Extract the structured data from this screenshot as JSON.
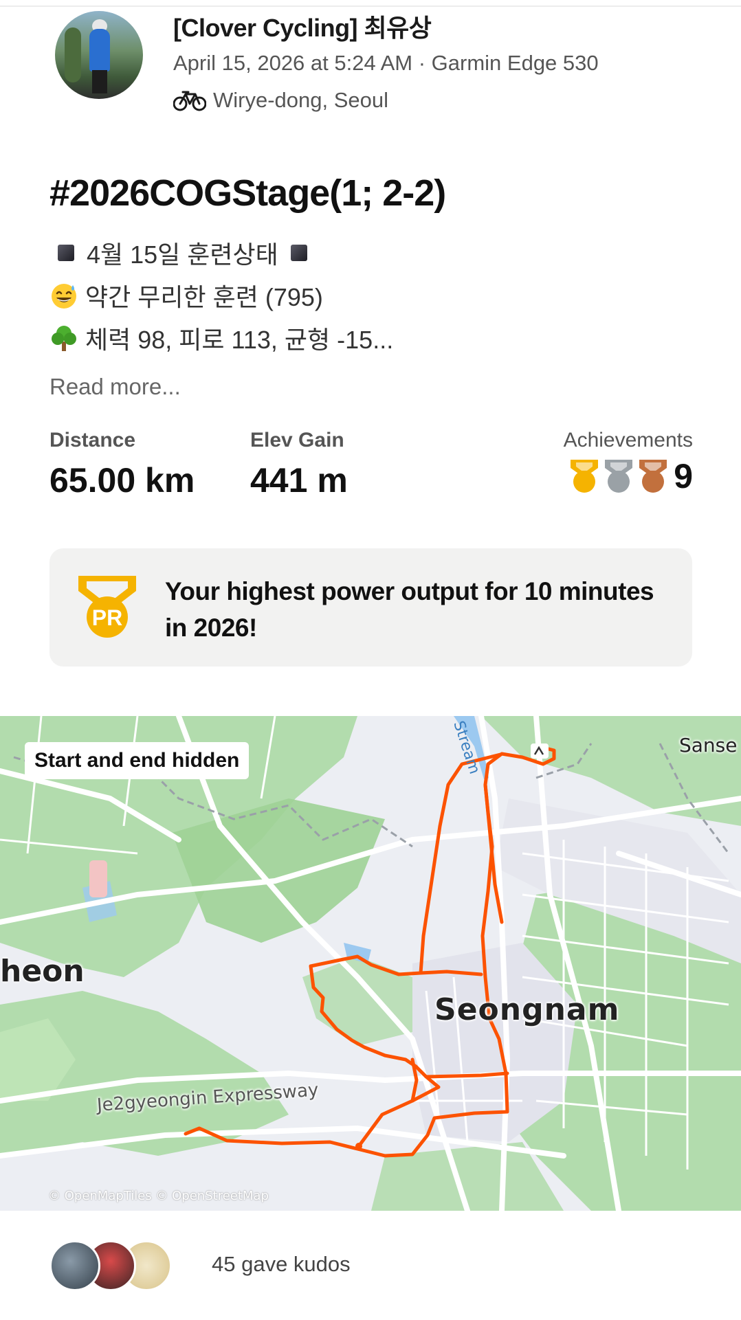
{
  "activity": {
    "athlete_name": "[Clover Cycling] 최유상",
    "meta": "April 15, 2026 at 5:24 AM · Garmin Edge 530",
    "location": "Wirye-dong, Seoul",
    "title": "#2026COGStage(1; 2-2)",
    "description_lines": [
      "4월 15일 훈련상태",
      "약간 무리한 훈련 (795)",
      "체력 98, 피로 113, 균형 -15..."
    ],
    "read_more": "Read more...",
    "icons": [
      "bike-icon",
      "black-square-icon",
      "sweat-smile-emoji",
      "tree-emoji"
    ]
  },
  "stats": {
    "distance_label": "Distance",
    "distance_value": "65.00 km",
    "elev_label": "Elev Gain",
    "elev_value": "441 m",
    "achievements_label": "Achievements",
    "achievements_count": "9",
    "medal_icons": [
      "gold-medal-icon",
      "silver-medal-icon",
      "bronze-medal-icon"
    ]
  },
  "pr_card": {
    "badge": "PR",
    "text": "Your highest power output for 10 minutes in 2026!"
  },
  "map": {
    "privacy_label": "Start and end hidden",
    "city_label": "Seongnam",
    "west_label": "heon",
    "east_label": "Sanse",
    "road_label": "Je2gyeongin Expressway",
    "stream_label": "Stream",
    "credit": "© OpenMapTiles © OpenStreetMap",
    "route_color": "#fc5200"
  },
  "kudos": {
    "text": "45 gave kudos"
  },
  "colors": {
    "accent": "#fc5200",
    "gold": "#f5b301",
    "silver": "#9aa1a6",
    "bronze": "#c2703d",
    "card_bg": "#f2f2f1"
  }
}
